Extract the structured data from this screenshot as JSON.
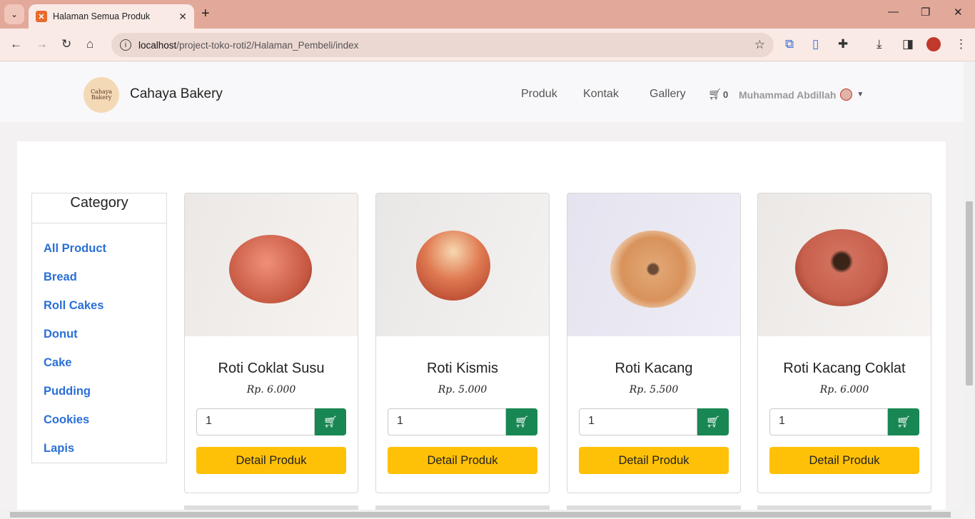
{
  "browser": {
    "tab_title": "Halaman Semua Produk",
    "url_host": "localhost",
    "url_path": "/project-toko-roti2/Halaman_Pembeli/index"
  },
  "navbar": {
    "brand": "Cahaya Bakery",
    "logo_text": "Cahaya Bakery",
    "links": [
      "Produk",
      "Kontak",
      "Gallery"
    ],
    "cart_count": "0",
    "user_name": "Muhammad Abdillah"
  },
  "category": {
    "title": "Category",
    "items": [
      "All Product",
      "Bread",
      "Roll Cakes",
      "Donut",
      "Cake",
      "Pudding",
      "Cookies",
      "Lapis"
    ]
  },
  "products": [
    {
      "name": "Roti Coklat Susu",
      "price": "Rp. 6.000",
      "qty": "1",
      "detail_label": "Detail Produk"
    },
    {
      "name": "Roti Kismis",
      "price": "Rp. 5.000",
      "qty": "1",
      "detail_label": "Detail Produk"
    },
    {
      "name": "Roti Kacang",
      "price": "Rp. 5.500",
      "qty": "1",
      "detail_label": "Detail Produk"
    },
    {
      "name": "Roti Kacang Coklat",
      "price": "Rp. 6.000",
      "qty": "1",
      "detail_label": "Detail Produk"
    }
  ],
  "colors": {
    "accent_blue": "#2a6fd6",
    "cart_green": "#198754",
    "detail_yellow": "#ffc107",
    "chrome_frame": "#e2a99a"
  }
}
